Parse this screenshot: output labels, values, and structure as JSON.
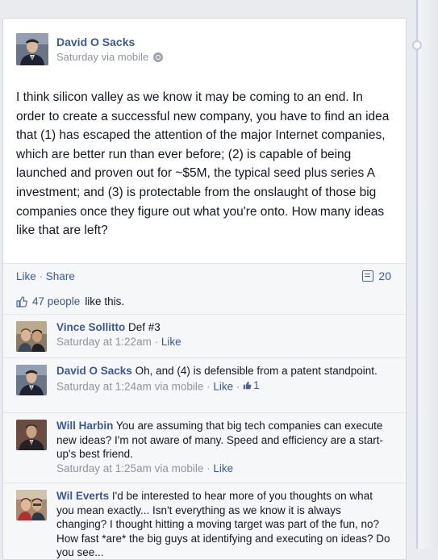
{
  "post": {
    "author": "David O Sacks",
    "meta": "Saturday via mobile",
    "body": "I think silicon valley as we know it may be coming to an end. In order to create a successful new company, you have to find an idea that (1) has escaped the attention of the major Internet companies, which are better run than ever before; (2) is capable of being launched and proven out for ~$5M, the typical seed plus series A investment; and (3) is protectable from the onslaught of those big companies once they figure out what you're onto. How many ideas like that are left?",
    "actions": {
      "like": "Like",
      "separator": "·",
      "share": "Share"
    },
    "comment_count": "20"
  },
  "likes": {
    "count_text": "47 people",
    "suffix": " like this."
  },
  "comments": [
    {
      "author": "Vince Sollitto",
      "text": "Def #3",
      "time": "Saturday at 1:22am",
      "separator": " · ",
      "like": "Like"
    },
    {
      "author": "David O Sacks",
      "text": "Oh, and (4) is defensible from a patent standpoint.",
      "time": "Saturday at 1:24am via mobile",
      "separator": " · ",
      "like": "Like",
      "separator2": " · ",
      "like_count": "1"
    },
    {
      "author": "Will Harbin",
      "text": "You are assuming that big tech companies can execute new ideas? I'm not aware of many. Speed and efficiency are a start-up's best friend.",
      "time": "Saturday at 1:25am via mobile",
      "separator": " · ",
      "like": "Like"
    },
    {
      "author": "Wil Everts",
      "text": "I'd be interested to hear more of you thoughts on what you mean exactly... Isn't everything as we know it is always changing? I thought hitting a moving target was part of the fun, no? How fast *are* the big guys at identifying and executing on ideas? Do you see...",
      "time": "",
      "separator": "",
      "like": ""
    }
  ],
  "icons": {
    "privacy": "globe-icon",
    "comments": "comment-bubble-icon",
    "like": "thumbs-up-icon"
  },
  "colors": {
    "link": "#3b5998",
    "meta": "#90949c",
    "background": "#e9ebee"
  }
}
